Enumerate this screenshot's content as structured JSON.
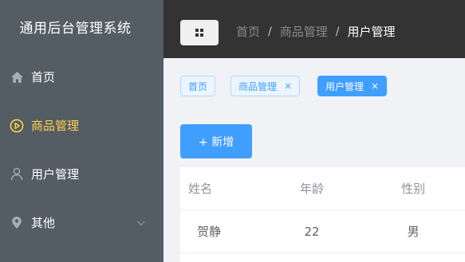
{
  "sidebar": {
    "title": "通用后台管理系统",
    "items": [
      {
        "label": "首页",
        "icon": "home-icon"
      },
      {
        "label": "商品管理",
        "icon": "play-circle-icon",
        "active": true
      },
      {
        "label": "用户管理",
        "icon": "user-icon"
      },
      {
        "label": "其他",
        "icon": "location-icon",
        "has_submenu": true
      }
    ],
    "colors": {
      "background": "#545c64",
      "text": "#ffffff",
      "active": "#ffd04b"
    }
  },
  "header": {
    "toggle_icon": "grid-menu-icon",
    "breadcrumb": [
      "首页",
      "商品管理",
      "用户管理"
    ],
    "separator": "/",
    "background": "#333333"
  },
  "tags": [
    {
      "label": "首页",
      "closable": false,
      "active": false
    },
    {
      "label": "商品管理",
      "closable": true,
      "active": false
    },
    {
      "label": "用户管理",
      "closable": true,
      "active": true
    }
  ],
  "tag_close_glyph": "×",
  "toolbar": {
    "add_label": "+ 新增"
  },
  "table": {
    "columns": [
      "姓名",
      "年龄",
      "性别"
    ],
    "rows": [
      [
        "贺静",
        "22",
        "男"
      ]
    ]
  },
  "accent": "#409eff"
}
